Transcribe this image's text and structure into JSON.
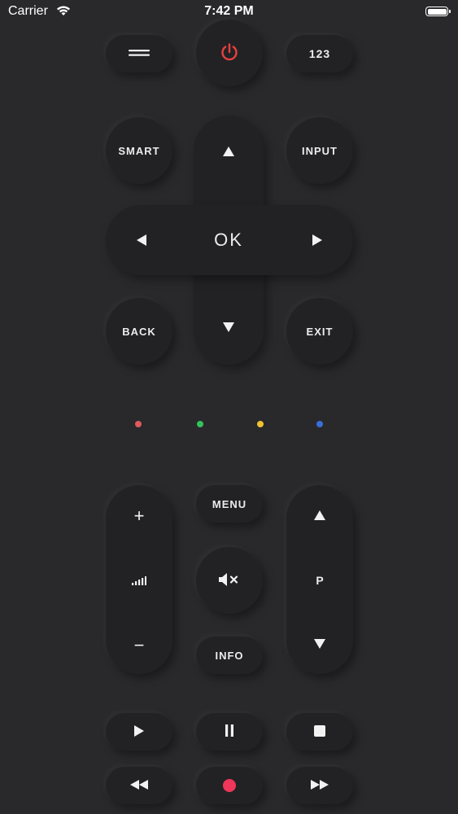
{
  "status_bar": {
    "carrier": "Carrier",
    "time": "7:42 PM"
  },
  "top_row": {
    "number_label": "123",
    "power_color": "#e8403f"
  },
  "nav": {
    "smart": "SMART",
    "input": "INPUT",
    "ok": "OK",
    "back": "BACK",
    "exit": "EXIT"
  },
  "color_keys": [
    {
      "name": "red",
      "color": "#e05a5a"
    },
    {
      "name": "green",
      "color": "#33c25a"
    },
    {
      "name": "yellow",
      "color": "#f0c232"
    },
    {
      "name": "blue",
      "color": "#3a6ed8"
    }
  ],
  "media_block": {
    "menu": "MENU",
    "info": "INFO",
    "volume_up": "+",
    "volume_down": "−",
    "channel_label": "P"
  },
  "transport": {
    "record_color": "#f0365a"
  },
  "icons": [
    "hamburger-icon",
    "power-icon",
    "up-arrow-icon",
    "down-arrow-icon",
    "left-arrow-icon",
    "right-arrow-icon",
    "signal-bars-icon",
    "mute-icon",
    "play-icon",
    "pause-icon",
    "stop-icon",
    "rewind-icon",
    "record-icon",
    "fast-forward-icon"
  ]
}
